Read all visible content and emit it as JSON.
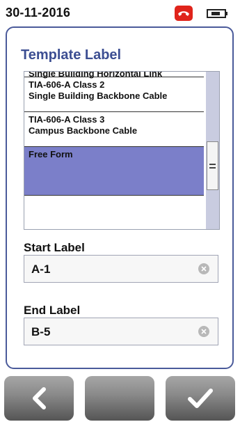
{
  "status_bar": {
    "date": "30-11-2016",
    "phone_icon": "phone-hangup-icon",
    "battery_icon": "battery-icon",
    "phone_color": "#e0241b"
  },
  "panel": {
    "title": "Template Label",
    "accent_color": "#3c4e92",
    "list": {
      "partial_item_line": "Single Building Horizontal Link",
      "items": [
        {
          "line1": "TIA-606-A Class 2",
          "line2": "Single Building Backbone Cable"
        },
        {
          "line1": "TIA-606-A Class 3",
          "line2": "Campus Backbone Cable"
        },
        {
          "line1": "Free Form",
          "selected": true
        }
      ],
      "selected_color": "#7b7fc9"
    },
    "start_label": {
      "label": "Start Label",
      "value": "A-1"
    },
    "end_label": {
      "label": "End Label",
      "value": "B-5"
    }
  },
  "bottom_bar": {
    "back_icon": "chevron-left-icon",
    "ok_icon": "checkmark-icon"
  }
}
